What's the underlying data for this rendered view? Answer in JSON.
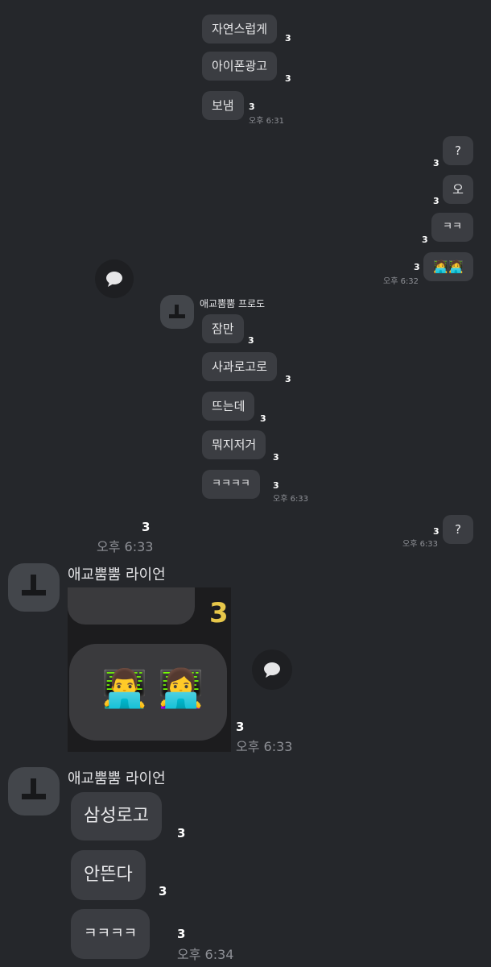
{
  "top_group": {
    "messages": [
      {
        "text": "자연스럽게",
        "count": "3"
      },
      {
        "text": "아이폰광고",
        "count": "3"
      },
      {
        "text": "보냄",
        "count": "3"
      }
    ],
    "time": "오후 6:31"
  },
  "right_group_1": {
    "messages": [
      {
        "text": "?",
        "count": "3"
      },
      {
        "text": "오",
        "count": "3"
      },
      {
        "text": "ㅋㅋ",
        "count": "3"
      },
      {
        "text": "🧑‍💻🧑‍💻",
        "count": "3"
      }
    ],
    "time": "오후 6:32"
  },
  "reply_icon": "speech-bubble-icon",
  "inner_sender": {
    "name": "애교뿜뿜 프로도",
    "messages": [
      {
        "text": "잠만",
        "count": "3"
      },
      {
        "text": "사과로고로",
        "count": "3"
      },
      {
        "text": "뜨는데",
        "count": "3"
      },
      {
        "text": "뭐지저거",
        "count": "3"
      },
      {
        "text": "ㅋㅋㅋㅋ",
        "count": "3"
      }
    ],
    "time": "오후 6:33"
  },
  "outer_row": {
    "count": "3",
    "time": "오후 6:33"
  },
  "right_group_2": {
    "text": "?",
    "count": "3",
    "time": "오후 6:33"
  },
  "sender_1": {
    "name": "애교뿜뿜 라이언",
    "image": {
      "count_badge": "3",
      "emoji_1": "👨‍💻",
      "emoji_2": "👩‍💻"
    },
    "count": "3",
    "time": "오후 6:33"
  },
  "sender_2": {
    "name": "애교뿜뿜 라이언",
    "messages": [
      {
        "text": "삼성로고",
        "count": "3"
      },
      {
        "text": "안뜬다",
        "count": "3"
      },
      {
        "text": "ㅋㅋㅋㅋ",
        "count": "3"
      }
    ],
    "time": "오후 6:34"
  },
  "colors": {
    "background": "#25272b",
    "bubble": "#3b3d42",
    "avatar": "#43464b",
    "count": "#ffffff",
    "time": "#8e9096"
  }
}
